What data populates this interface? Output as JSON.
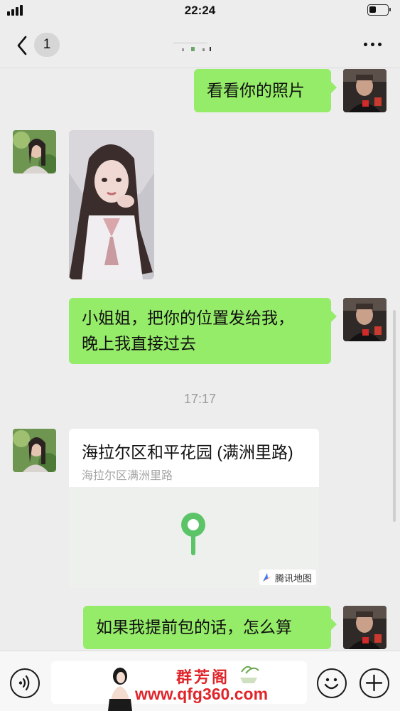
{
  "status_bar": {
    "time": "22:24",
    "battery_level_percent": 40
  },
  "nav": {
    "unread_count": "1"
  },
  "messages": {
    "m1": "看看你的照片",
    "m3_line1": "小姐姐，把你的位置发给我，",
    "m3_line2": "晚上我直接过去",
    "time_divider": "17:17",
    "m5": "如果我提前包的话，怎么算"
  },
  "location": {
    "title": "海拉尔区和平花园 (满洲里路)",
    "address": "海拉尔区满洲里路",
    "provider": "腾讯地图"
  },
  "watermark": {
    "name": "群芳阁",
    "url": "www.qfg360.com"
  },
  "colors": {
    "my_bubble": "#95ec69",
    "pin": "#5ac466",
    "background": "#ededed"
  },
  "icons": [
    "back-chevron-icon",
    "more-icon",
    "voice-icon",
    "emoji-icon",
    "plus-icon",
    "map-pin-icon",
    "map-provider-icon"
  ]
}
